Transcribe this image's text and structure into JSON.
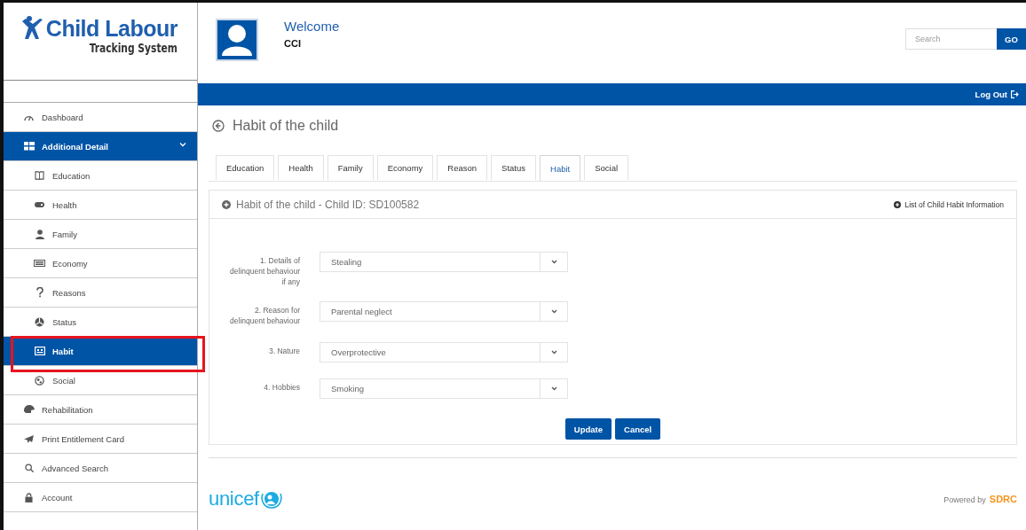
{
  "logo": {
    "title": "Child Labour",
    "subtitle": "Tracking System"
  },
  "sidebar": {
    "items": [
      {
        "label": "Dashboard",
        "selected": false
      },
      {
        "label": "Additional Detail",
        "selected": false,
        "expanded": true,
        "children": [
          {
            "label": "Education",
            "selected": false,
            "marked": false
          },
          {
            "label": "Health",
            "selected": false,
            "marked": false
          },
          {
            "label": "Family",
            "selected": false,
            "marked": false
          },
          {
            "label": "Economy",
            "selected": false,
            "marked": false
          },
          {
            "label": "Reasons",
            "selected": false,
            "marked": false
          },
          {
            "label": "Status",
            "selected": false,
            "marked": false
          },
          {
            "label": "Habit",
            "selected": true,
            "marked": true
          },
          {
            "label": "Social",
            "selected": false,
            "marked": false
          }
        ]
      },
      {
        "label": "Rehabilitation",
        "selected": false
      },
      {
        "label": "Print Entitlement Card",
        "selected": false
      },
      {
        "label": "Advanced Search",
        "selected": false
      },
      {
        "label": "Account",
        "selected": false
      }
    ]
  },
  "header": {
    "greeting": "Welcome",
    "user": "CCI",
    "search": {
      "placeholder": "Search",
      "button": "GO"
    },
    "logout": "Log Out"
  },
  "page_title": "Habit of the child",
  "tabs": [
    {
      "label": "Education",
      "selected": false
    },
    {
      "label": "Health",
      "selected": false
    },
    {
      "label": "Family",
      "selected": false
    },
    {
      "label": "Economy",
      "selected": false
    },
    {
      "label": "Reason",
      "selected": false
    },
    {
      "label": "Status",
      "selected": false
    },
    {
      "label": "Habit",
      "selected": true
    },
    {
      "label": "Social",
      "selected": false
    }
  ],
  "panel": {
    "title": "Habit of the child - Child ID: SD100582",
    "link": "List of Child Habit Information",
    "fields": [
      {
        "label": "1. Details of delinquent behaviour if any",
        "value": "Stealing"
      },
      {
        "label": "2. Reason for delinquent behaviour",
        "value": "Parental neglect"
      },
      {
        "label": "3. Nature",
        "value": "Overprotective"
      },
      {
        "label": "4. Hobbies",
        "value": "Smoking"
      }
    ],
    "buttons": [
      "Update",
      "Cancel"
    ]
  },
  "footer": {
    "brand": "unicef",
    "powered_by": "Powered by",
    "company": "SDRC"
  }
}
